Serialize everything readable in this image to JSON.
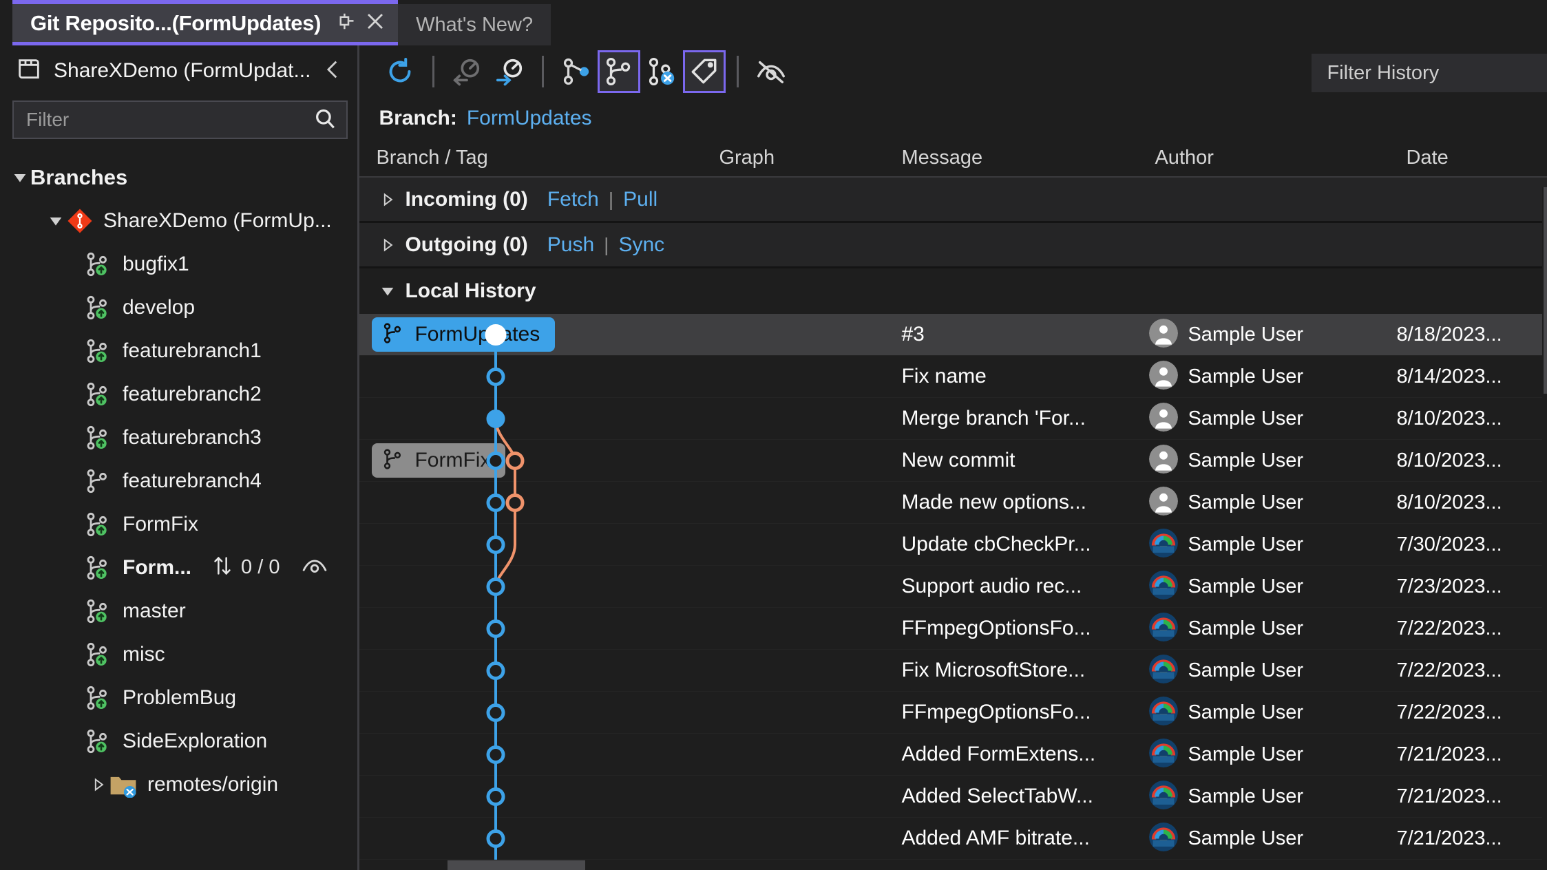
{
  "tabs": [
    {
      "title": "Git Reposito...(FormUpdates)",
      "active": true,
      "pin_icon": "pin-icon",
      "close_icon": "close-icon"
    },
    {
      "title": "What's New?",
      "active": false
    }
  ],
  "sidebar": {
    "repo_title": "ShareXDemo (FormUpdat...",
    "collapse_icon": "chevron-left-icon",
    "filter": {
      "placeholder": "Filter",
      "icon": "search-icon"
    },
    "tree": {
      "root_label": "Branches",
      "repo_label": "ShareXDemo (FormUp...",
      "branches": [
        {
          "label": "bugfix1",
          "tracked": true,
          "current": false
        },
        {
          "label": "develop",
          "tracked": true,
          "current": false
        },
        {
          "label": "featurebranch1",
          "tracked": true,
          "current": false
        },
        {
          "label": "featurebranch2",
          "tracked": true,
          "current": false
        },
        {
          "label": "featurebranch3",
          "tracked": true,
          "current": false
        },
        {
          "label": "featurebranch4",
          "tracked": false,
          "current": false
        },
        {
          "label": "FormFix",
          "tracked": true,
          "current": false
        },
        {
          "label": "Form...",
          "tracked": true,
          "current": true,
          "ahead_behind": "0 / 0",
          "eye_icon": "eye-icon",
          "arrows_icon": "up-down-arrows-icon"
        },
        {
          "label": "master",
          "tracked": true,
          "current": false
        },
        {
          "label": "misc",
          "tracked": true,
          "current": false
        },
        {
          "label": "ProblemBug",
          "tracked": true,
          "current": false
        },
        {
          "label": "SideExploration",
          "tracked": true,
          "current": false
        }
      ],
      "remotes_label": "remotes/origin"
    }
  },
  "toolbar": {
    "buttons": [
      {
        "name": "refresh-icon",
        "selected": false
      },
      {
        "name": "fetch-icon",
        "selected": false,
        "disabled": true
      },
      {
        "name": "pull-icon",
        "selected": false
      },
      {
        "name": "branch-graph-icon",
        "selected": false
      },
      {
        "name": "local-branches-icon",
        "selected": true
      },
      {
        "name": "remote-branches-icon",
        "selected": false
      },
      {
        "name": "tags-icon",
        "selected": true
      },
      {
        "name": "hide-eye-off-icon",
        "selected": false
      }
    ],
    "filter_history_placeholder": "Filter History"
  },
  "branch_line": {
    "label": "Branch:",
    "value": "FormUpdates"
  },
  "columns": [
    "Branch / Tag",
    "Graph",
    "Message",
    "Author",
    "Date"
  ],
  "groups": [
    {
      "name": "Incoming (0)",
      "links": [
        "Fetch",
        "Pull"
      ],
      "expanded": false
    },
    {
      "name": "Outgoing (0)",
      "links": [
        "Push",
        "Sync"
      ],
      "expanded": false
    },
    {
      "name": "Local History",
      "links": [],
      "expanded": true
    }
  ],
  "commits": [
    {
      "chip": "FormUpdates",
      "chip_style": "blue",
      "message": "#3",
      "author": "Sample User",
      "date": "8/18/2023...",
      "selected": true,
      "avatar": "gray"
    },
    {
      "chip": "",
      "chip_style": "",
      "message": "Fix name",
      "author": "Sample User",
      "date": "8/14/2023...",
      "selected": false,
      "avatar": "gray"
    },
    {
      "chip": "",
      "chip_style": "",
      "message": "Merge branch 'For...",
      "author": "Sample User",
      "date": "8/10/2023...",
      "selected": false,
      "avatar": "gray"
    },
    {
      "chip": "FormFix",
      "chip_style": "gray",
      "message": "New commit",
      "author": "Sample User",
      "date": "8/10/2023...",
      "selected": false,
      "avatar": "gray"
    },
    {
      "chip": "",
      "chip_style": "",
      "message": "Made new options...",
      "author": "Sample User",
      "date": "8/10/2023...",
      "selected": false,
      "avatar": "gray"
    },
    {
      "chip": "",
      "chip_style": "",
      "message": "Update cbCheckPr...",
      "author": "Sample User",
      "date": "7/30/2023...",
      "selected": false,
      "avatar": "color"
    },
    {
      "chip": "",
      "chip_style": "",
      "message": "Support audio rec...",
      "author": "Sample User",
      "date": "7/23/2023...",
      "selected": false,
      "avatar": "color"
    },
    {
      "chip": "",
      "chip_style": "",
      "message": "FFmpegOptionsFo...",
      "author": "Sample User",
      "date": "7/22/2023...",
      "selected": false,
      "avatar": "color"
    },
    {
      "chip": "",
      "chip_style": "",
      "message": "Fix MicrosoftStore...",
      "author": "Sample User",
      "date": "7/22/2023...",
      "selected": false,
      "avatar": "color"
    },
    {
      "chip": "",
      "chip_style": "",
      "message": "FFmpegOptionsFo...",
      "author": "Sample User",
      "date": "7/22/2023...",
      "selected": false,
      "avatar": "color"
    },
    {
      "chip": "",
      "chip_style": "",
      "message": "Added FormExtens...",
      "author": "Sample User",
      "date": "7/21/2023...",
      "selected": false,
      "avatar": "color"
    },
    {
      "chip": "",
      "chip_style": "",
      "message": "Added SelectTabW...",
      "author": "Sample User",
      "date": "7/21/2023...",
      "selected": false,
      "avatar": "color"
    },
    {
      "chip": "",
      "chip_style": "",
      "message": "Added AMF bitrate...",
      "author": "Sample User",
      "date": "7/21/2023...",
      "selected": false,
      "avatar": "color"
    }
  ],
  "graph": {
    "main_color": "#3da2e8",
    "branch_color": "#f0936b",
    "head_color": "#ffffff"
  }
}
